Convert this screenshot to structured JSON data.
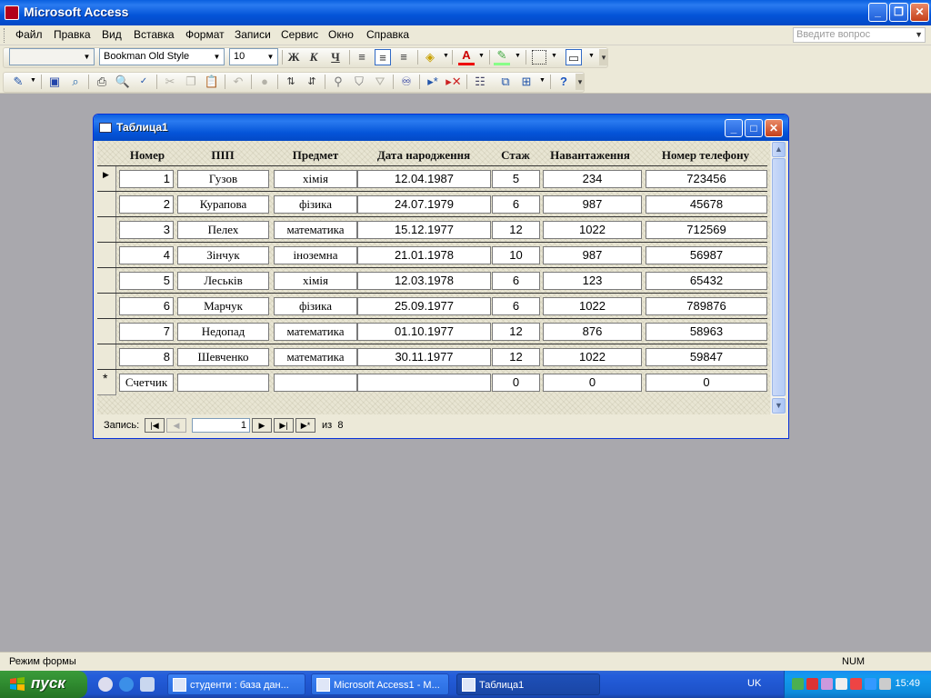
{
  "app": {
    "title": "Microsoft Access"
  },
  "menu": {
    "items": [
      "Файл",
      "Правка",
      "Вид",
      "Вставка",
      "Формат",
      "Записи",
      "Сервис",
      "Окно",
      "Справка"
    ],
    "help_placeholder": "Введите вопрос"
  },
  "toolbar": {
    "font_name": "Bookman Old Style",
    "font_size": "10",
    "bold": "Ж",
    "italic": "К",
    "underline": "Ч",
    "font_color_glyph": "A"
  },
  "child_window": {
    "title": "Таблица1"
  },
  "table": {
    "headers": [
      "Номер",
      "ПІП",
      "Предмет",
      "Дата народження",
      "Стаж",
      "Навантаження",
      "Номер телефону"
    ],
    "rows": [
      [
        "1",
        "Гузов",
        "хімія",
        "12.04.1987",
        "5",
        "234",
        "723456"
      ],
      [
        "2",
        "Курапова",
        "фізика",
        "24.07.1979",
        "6",
        "987",
        "45678"
      ],
      [
        "3",
        "Пелех",
        "математика",
        "15.12.1977",
        "12",
        "1022",
        "712569"
      ],
      [
        "4",
        "Зінчук",
        "іноземна",
        "21.01.1978",
        "10",
        "987",
        "56987"
      ],
      [
        "5",
        "Леськів",
        "хімія",
        "12.03.1978",
        "6",
        "123",
        "65432"
      ],
      [
        "6",
        "Марчук",
        "фізика",
        "25.09.1977",
        "6",
        "1022",
        "789876"
      ],
      [
        "7",
        "Недопад",
        "математика",
        "01.10.1977",
        "12",
        "876",
        "58963"
      ],
      [
        "8",
        "Шевченко",
        "математика",
        "30.11.1977",
        "12",
        "1022",
        "59847"
      ]
    ],
    "new_row": [
      "Счетчик",
      "",
      "",
      "",
      "0",
      "0",
      "0"
    ],
    "new_row_marker": "*",
    "current_marker": "▶"
  },
  "navigation": {
    "label": "Запись:",
    "current": "1",
    "of_label": "из",
    "total": "8"
  },
  "status": {
    "mode": "Режим формы",
    "num": "NUM"
  },
  "taskbar": {
    "start": "пуск",
    "tasks": [
      "студенти : база дан...",
      "Microsoft Access1 - M...",
      "Таблица1"
    ],
    "lang": "UK",
    "clock": "15:49"
  }
}
